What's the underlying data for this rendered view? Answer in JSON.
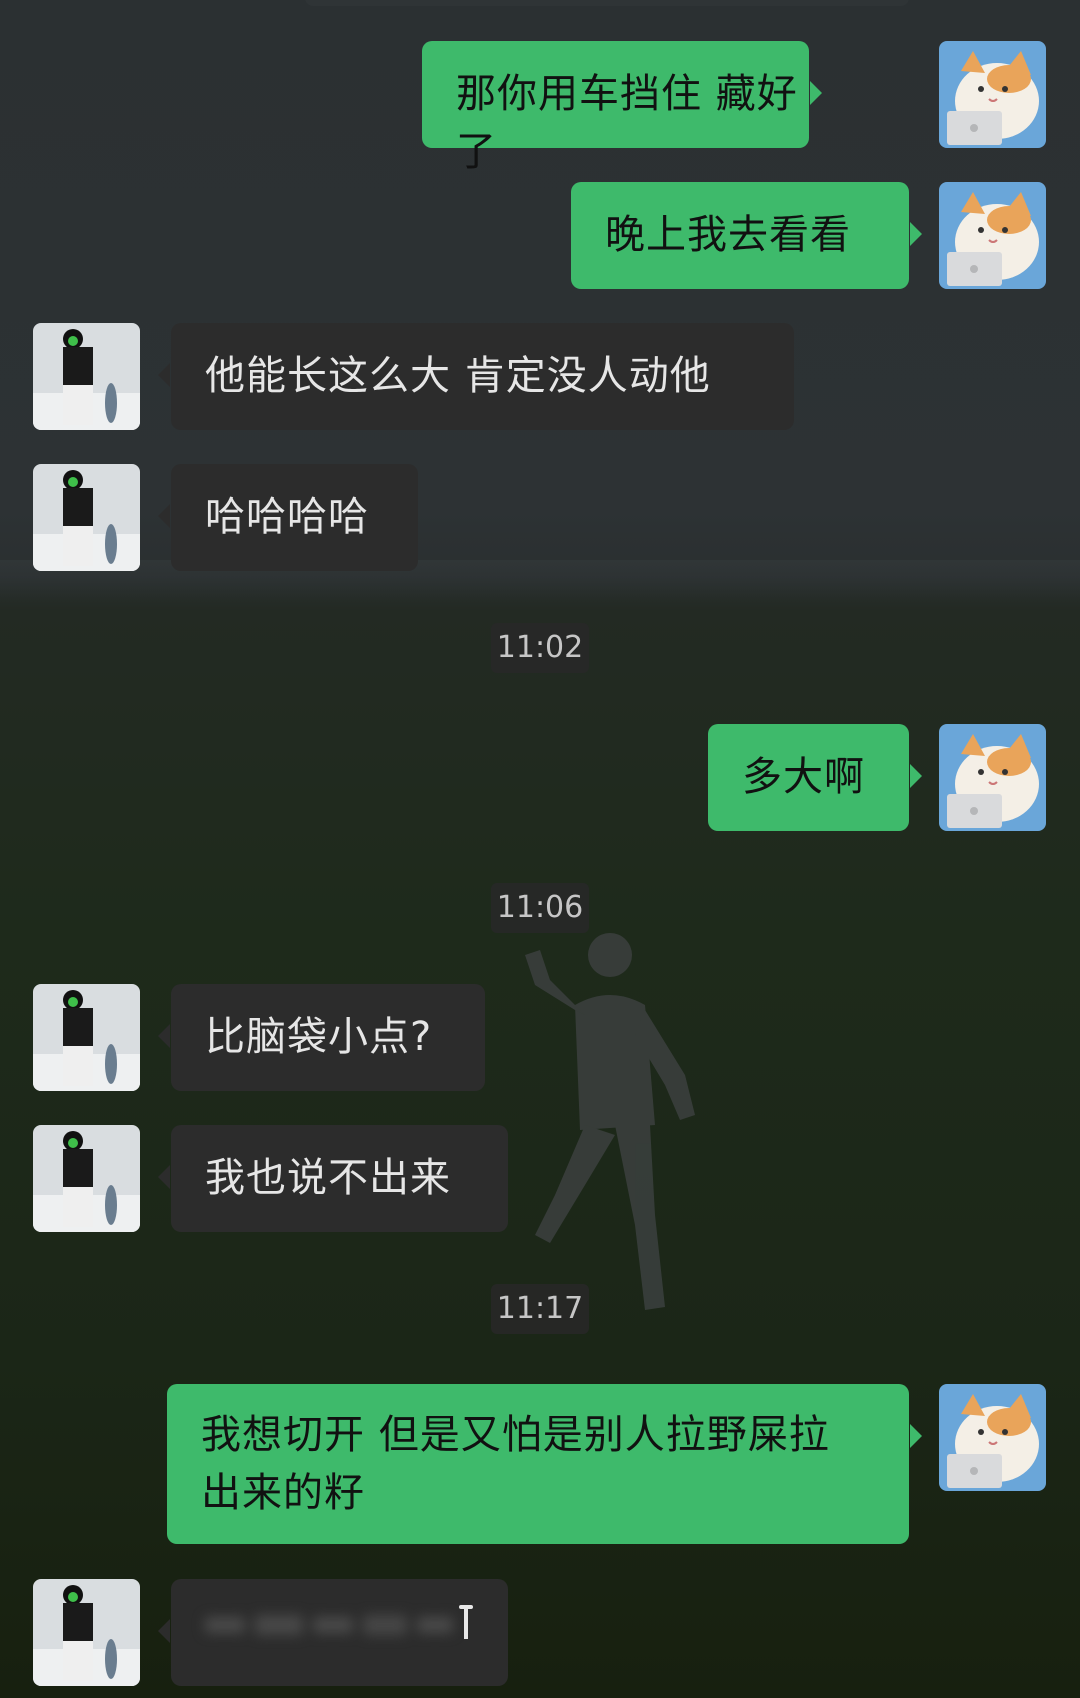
{
  "theme": {
    "sent_bubble": "#3eba6b",
    "received_bubble": "#2c2c2c",
    "timestamp_bg": "#282828"
  },
  "avatars": {
    "me": "cat-with-laptop-avatar",
    "contact": "person-snowboard-avatar"
  },
  "messages": [
    {
      "sender": "me",
      "text": "那你用车挡住 藏好了"
    },
    {
      "sender": "me",
      "text": "晚上我去看看"
    },
    {
      "sender": "contact",
      "text": "他能长这么大 肯定没人动他"
    },
    {
      "sender": "contact",
      "text": "哈哈哈哈"
    },
    {
      "type": "time",
      "text": "11:02"
    },
    {
      "sender": "me",
      "text": "多大啊"
    },
    {
      "type": "time",
      "text": "11:06"
    },
    {
      "sender": "contact",
      "text": "比脑袋小点?"
    },
    {
      "sender": "contact",
      "text": "我也说不出来"
    },
    {
      "type": "time",
      "text": "11:17"
    },
    {
      "sender": "me",
      "text": "我想切开 但是又怕是别人拉野屎拉",
      "text_line2": "出来的籽"
    },
    {
      "sender": "contact",
      "text": "",
      "note": ""
    }
  ]
}
